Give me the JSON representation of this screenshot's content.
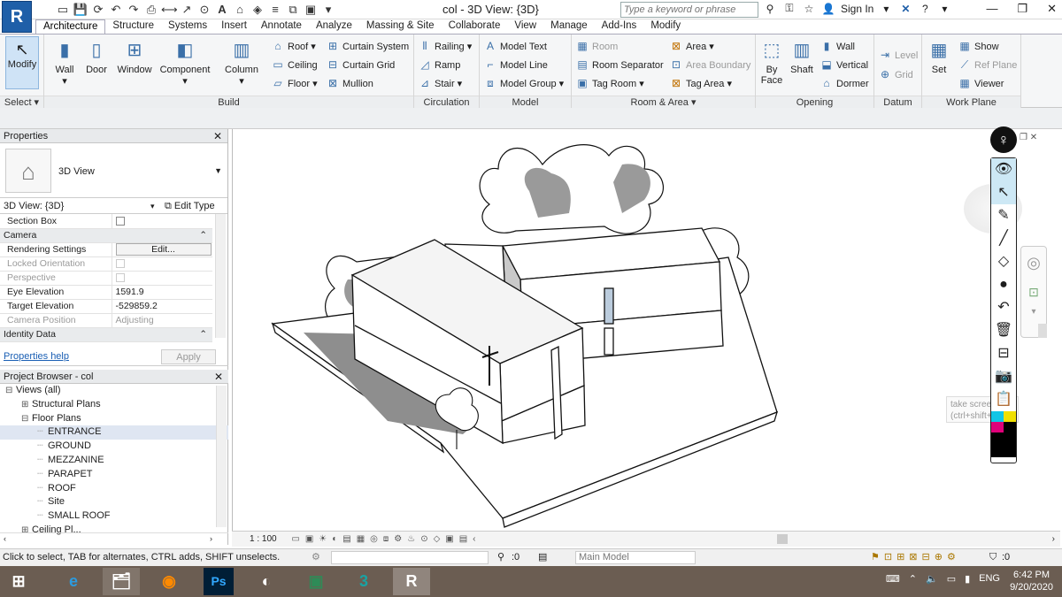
{
  "window": {
    "app_logo": "R",
    "title": "col - 3D View: {3D}",
    "search_placeholder": "Type a keyword or phrase",
    "sign_in": "Sign In",
    "help": "?"
  },
  "tabs": [
    "Architecture",
    "Structure",
    "Systems",
    "Insert",
    "Annotate",
    "Analyze",
    "Massing & Site",
    "Collaborate",
    "View",
    "Manage",
    "Add-Ins",
    "Modify"
  ],
  "ribbon": {
    "select": {
      "modify": "Modify",
      "label": "Select"
    },
    "build": {
      "label": "Build",
      "big": [
        "Wall",
        "Door",
        "Window",
        "Component",
        "Column"
      ],
      "small": [
        "Roof",
        "Ceiling",
        "Floor",
        "Curtain System",
        "Curtain Grid",
        "Mullion"
      ]
    },
    "circulation": {
      "label": "Circulation",
      "items": [
        "Railing",
        "Ramp",
        "Stair"
      ]
    },
    "model": {
      "label": "Model",
      "items": [
        "Model Text",
        "Model Line",
        "Model Group"
      ]
    },
    "room_area": {
      "label": "Room & Area",
      "items": [
        "Room",
        "Room Separator",
        "Tag Room",
        "Area",
        "Area Boundary",
        "Tag Area"
      ]
    },
    "opening": {
      "label": "Opening",
      "by_face": "By Face",
      "shaft": "Shaft",
      "items": [
        "Wall",
        "Vertical",
        "Dormer"
      ]
    },
    "datum": {
      "label": "Datum",
      "items": [
        "Level",
        "Grid"
      ]
    },
    "work_plane": {
      "label": "Work Plane",
      "set": "Set",
      "items": [
        "Show",
        "Ref Plane",
        "Viewer"
      ]
    }
  },
  "properties": {
    "title": "Properties",
    "type_name": "3D View",
    "instance": "3D View: {3D}",
    "edit_type": "Edit Type",
    "rows": [
      {
        "label": "Section Box",
        "value": "",
        "kind": "check"
      },
      {
        "label": "Camera",
        "kind": "category"
      },
      {
        "label": "Rendering Settings",
        "value": "Edit...",
        "kind": "button"
      },
      {
        "label": "Locked Orientation",
        "value": "",
        "kind": "check-dim"
      },
      {
        "label": "Perspective",
        "value": "",
        "kind": "check-dim"
      },
      {
        "label": "Eye Elevation",
        "value": "1591.9",
        "kind": "text"
      },
      {
        "label": "Target Elevation",
        "value": "-529859.2",
        "kind": "text"
      },
      {
        "label": "Camera Position",
        "value": "Adjusting",
        "kind": "dim"
      },
      {
        "label": "Identity Data",
        "kind": "category"
      }
    ],
    "help_link": "Properties help",
    "apply": "Apply"
  },
  "browser": {
    "title": "Project Browser - col",
    "items": [
      {
        "label": "Views (all)",
        "level": 0,
        "expander": "−"
      },
      {
        "label": "Structural Plans",
        "level": 1,
        "expander": "+"
      },
      {
        "label": "Floor Plans",
        "level": 1,
        "expander": "−"
      },
      {
        "label": "ENTRANCE",
        "level": 2,
        "selected": true
      },
      {
        "label": "GROUND",
        "level": 2
      },
      {
        "label": "MEZZANINE",
        "level": 2
      },
      {
        "label": "PARAPET",
        "level": 2
      },
      {
        "label": "ROOF",
        "level": 2
      },
      {
        "label": "Site",
        "level": 2
      },
      {
        "label": "SMALL ROOF",
        "level": 2
      },
      {
        "label": "Ceiling Pl...",
        "level": 1,
        "expander": "+"
      }
    ]
  },
  "viewbar": {
    "scale": "1 : 100"
  },
  "tooltip": {
    "line1": "take scree",
    "line2": "(ctrl+shift+"
  },
  "status": {
    "message": "Click to select, TAB for alternates, CTRL adds, SHIFT unselects.",
    "worksets": ":0",
    "model": "Main Model",
    "filter": ":0"
  },
  "taskbar": {
    "lang": "ENG",
    "time": "6:42 PM",
    "date": "9/20/2020"
  }
}
